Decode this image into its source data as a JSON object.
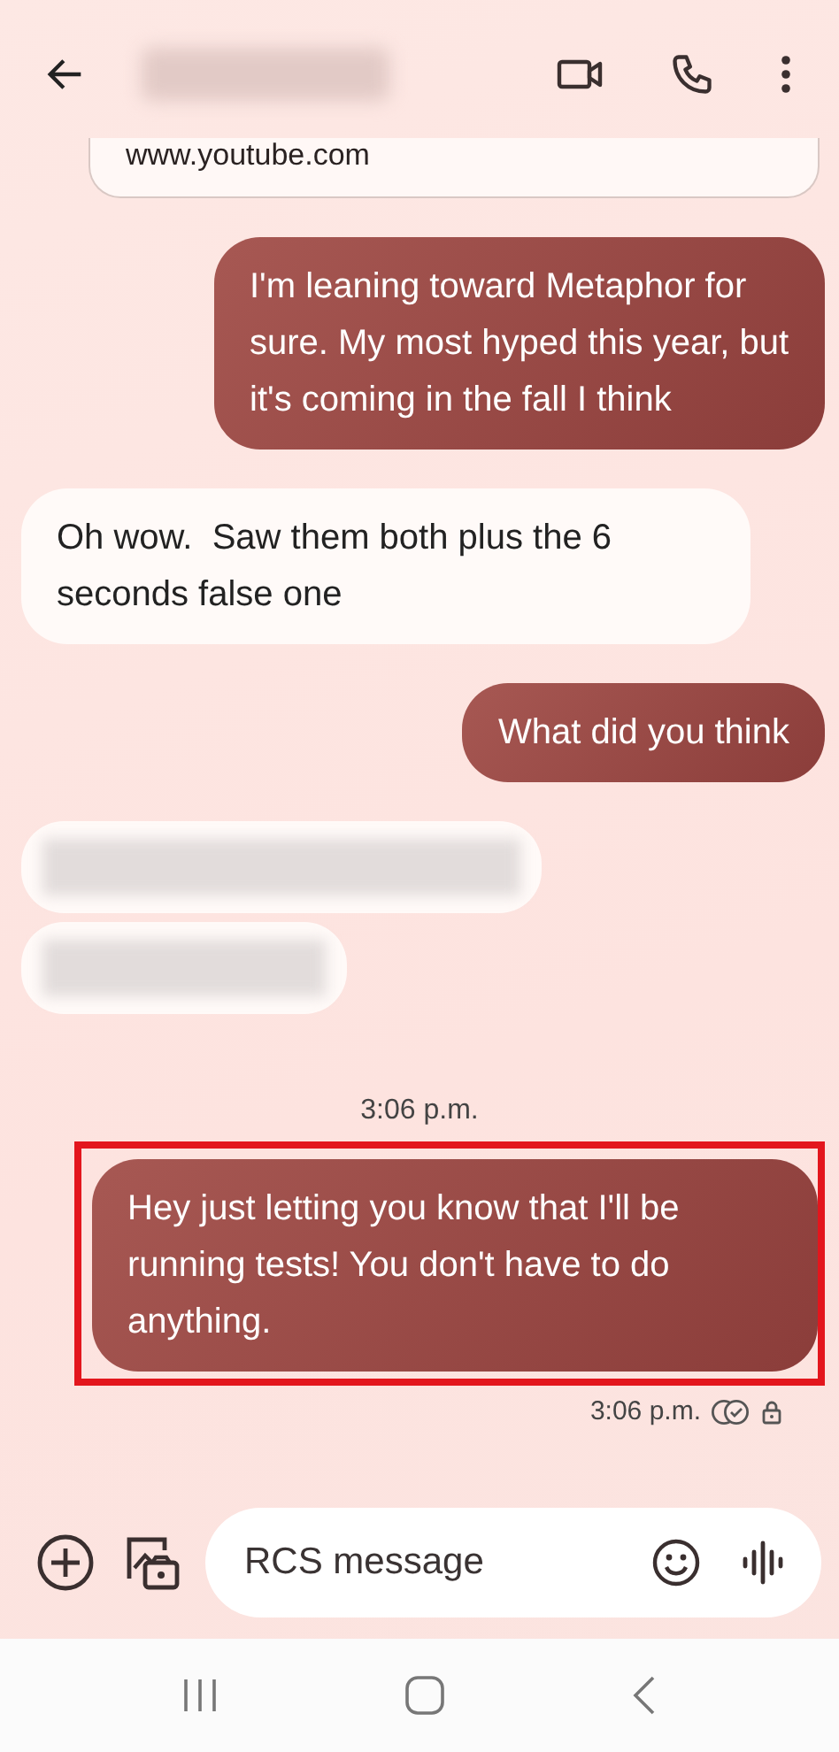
{
  "header": {
    "name_blurred": true
  },
  "messages": [
    {
      "kind": "link_preview",
      "text": "www.youtube.com"
    },
    {
      "kind": "text",
      "sent": true,
      "text": "I'm leaning toward Metaphor for sure. My most hyped this year, but it's coming in the fall I think",
      "highlighted": false
    },
    {
      "kind": "text",
      "sent": false,
      "text": "Oh wow.  Saw them both plus the 6 seconds false one",
      "highlighted": false
    },
    {
      "kind": "text",
      "sent": true,
      "text": "What did you think",
      "highlighted": false
    },
    {
      "kind": "blurred",
      "sent": false
    },
    {
      "kind": "blurred",
      "sent": false
    },
    {
      "kind": "timestamp",
      "text": "3:06 p.m."
    },
    {
      "kind": "text",
      "sent": true,
      "text": "Hey just letting you know that I'll be running tests! You don't have to do anything.",
      "highlighted": true
    },
    {
      "kind": "status",
      "text": "3:06 p.m.",
      "read": true,
      "encrypted": true
    }
  ],
  "composer": {
    "placeholder": "RCS message"
  }
}
